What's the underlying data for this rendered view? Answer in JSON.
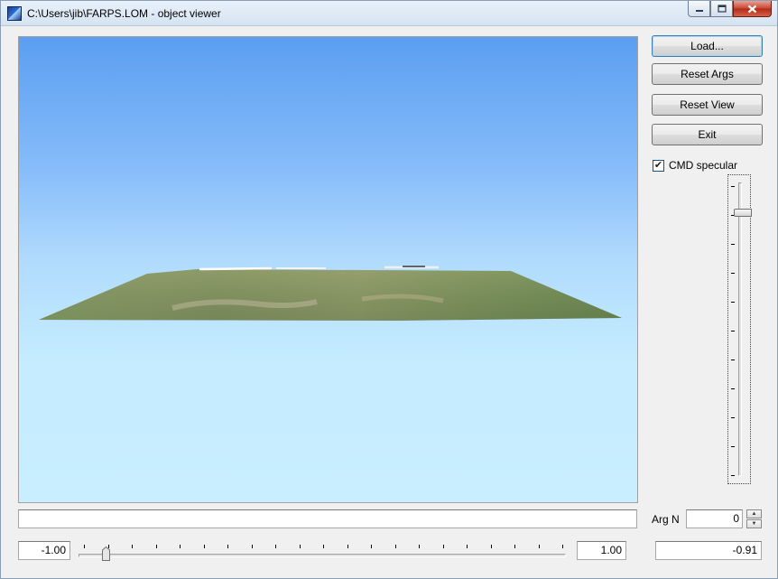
{
  "window": {
    "title": "C:\\Users\\jib\\FARPS.LOM - object viewer",
    "minimize_icon": "minimize-icon",
    "maximize_icon": "maximize-icon",
    "close_icon": "close-icon"
  },
  "toolbar": {
    "load_label": "Load...",
    "reset_args_label": "Reset Args",
    "reset_view_label": "Reset View",
    "exit_label": "Exit"
  },
  "options": {
    "cmd_specular_label": "CMD specular",
    "cmd_specular_checked": true,
    "check_glyph": "✔"
  },
  "arg_slider": {
    "level_fraction": 0.09
  },
  "arg_n": {
    "label": "Arg N",
    "value": "0",
    "up_glyph": "▲",
    "down_glyph": "▼"
  },
  "range": {
    "min_value": "-1.00",
    "max_value": "1.00",
    "current_value": "-0.91",
    "position_fraction": 0.045
  },
  "status": {
    "text": ""
  },
  "colors": {
    "sky_top": "#5b9ef0",
    "sky_bottom": "#c8eeff",
    "terrain": "#6f8a55"
  }
}
